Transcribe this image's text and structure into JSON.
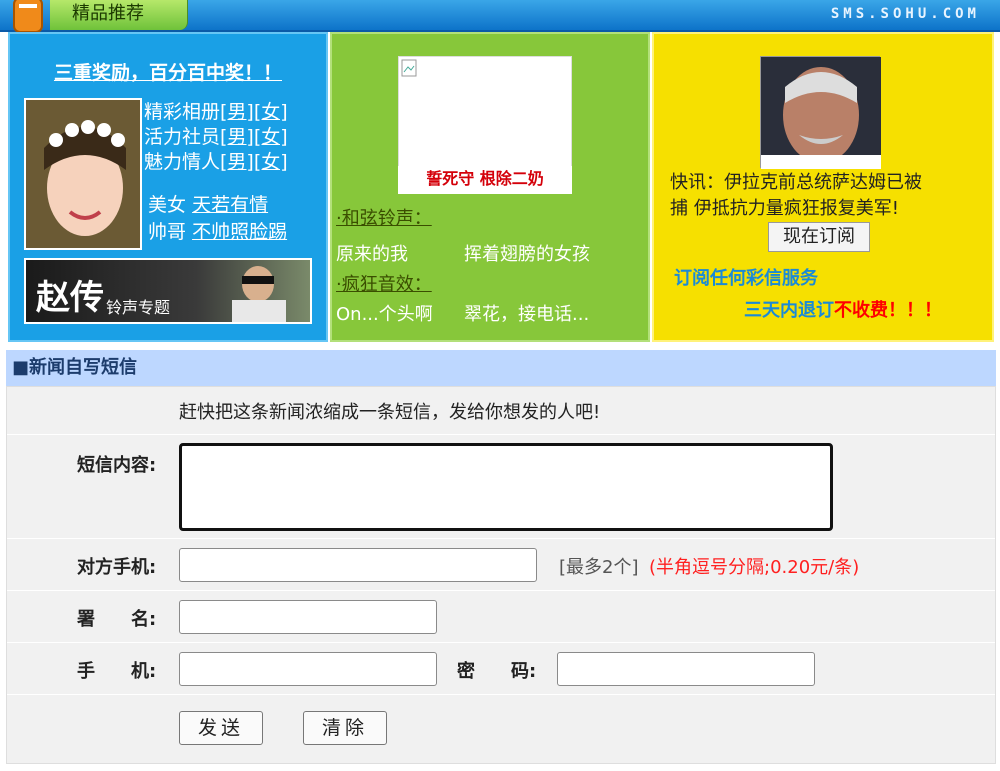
{
  "header": {
    "tab_label": "精品推荐",
    "brand": "SMS.SOHU.COM"
  },
  "promo_blue": {
    "title": "三重奖励，百分百中奖！！",
    "lines": [
      {
        "text": "精彩相册",
        "male": "[男]",
        "female": "[女]"
      },
      {
        "text": "活力社员",
        "male": "[男]",
        "female": "[女]"
      },
      {
        "text": "魅力情人",
        "male": "[男]",
        "female": "[女]"
      }
    ],
    "beauty_prefix": "美女",
    "beauty_link": "天若有情",
    "handsome_prefix": "帅哥",
    "handsome_link": "不帅照脸踢",
    "banner_title": "赵传",
    "banner_sub": "铃声专题"
  },
  "promo_green": {
    "ad_text": "誓死守 根除二奶",
    "chord_heading": "·和弦铃声：",
    "chord_items": [
      "原来的我",
      "挥着翅膀的女孩"
    ],
    "crazy_heading": "·疯狂音效：",
    "crazy_items": [
      "On...个头啊",
      "翠花，接电话..."
    ]
  },
  "promo_yellow": {
    "news": "快讯：伊拉克前总统萨达姆已被捕 伊抵抗力量疯狂报复美军!",
    "news_line1": "快讯：伊拉克前总统萨达姆已被",
    "news_line2": "捕 伊抵抗力量疯狂报复美军!",
    "subscribe_button": "现在订阅",
    "subscribe_any": "订阅任何彩信服务",
    "free_prefix": "三天内退订",
    "free_red": "不收费！！！"
  },
  "form": {
    "section_title": "■新闻自写短信",
    "intro": "赶快把这条新闻浓缩成一条短信，发给你想发的人吧!",
    "content_label": "短信内容:",
    "content_value": "",
    "phone_label": "对方手机:",
    "phone_value": "",
    "phone_hint_gray": "[最多2个]",
    "phone_hint_red": "(半角逗号分隔;0.20元/条)",
    "signature_label": "署　　名:",
    "signature_value": "",
    "mobile_label": "手　　机:",
    "mobile_value": "",
    "password_label": "密　　码:",
    "password_value": "",
    "send_button": "发送",
    "clear_button": "清除"
  },
  "colors": {
    "blue_panel": "#1aa0e6",
    "green_panel": "#87c73a",
    "yellow_panel": "#f6e000",
    "section_bar": "#bdd7ff",
    "hint_red": "#ff2020"
  }
}
